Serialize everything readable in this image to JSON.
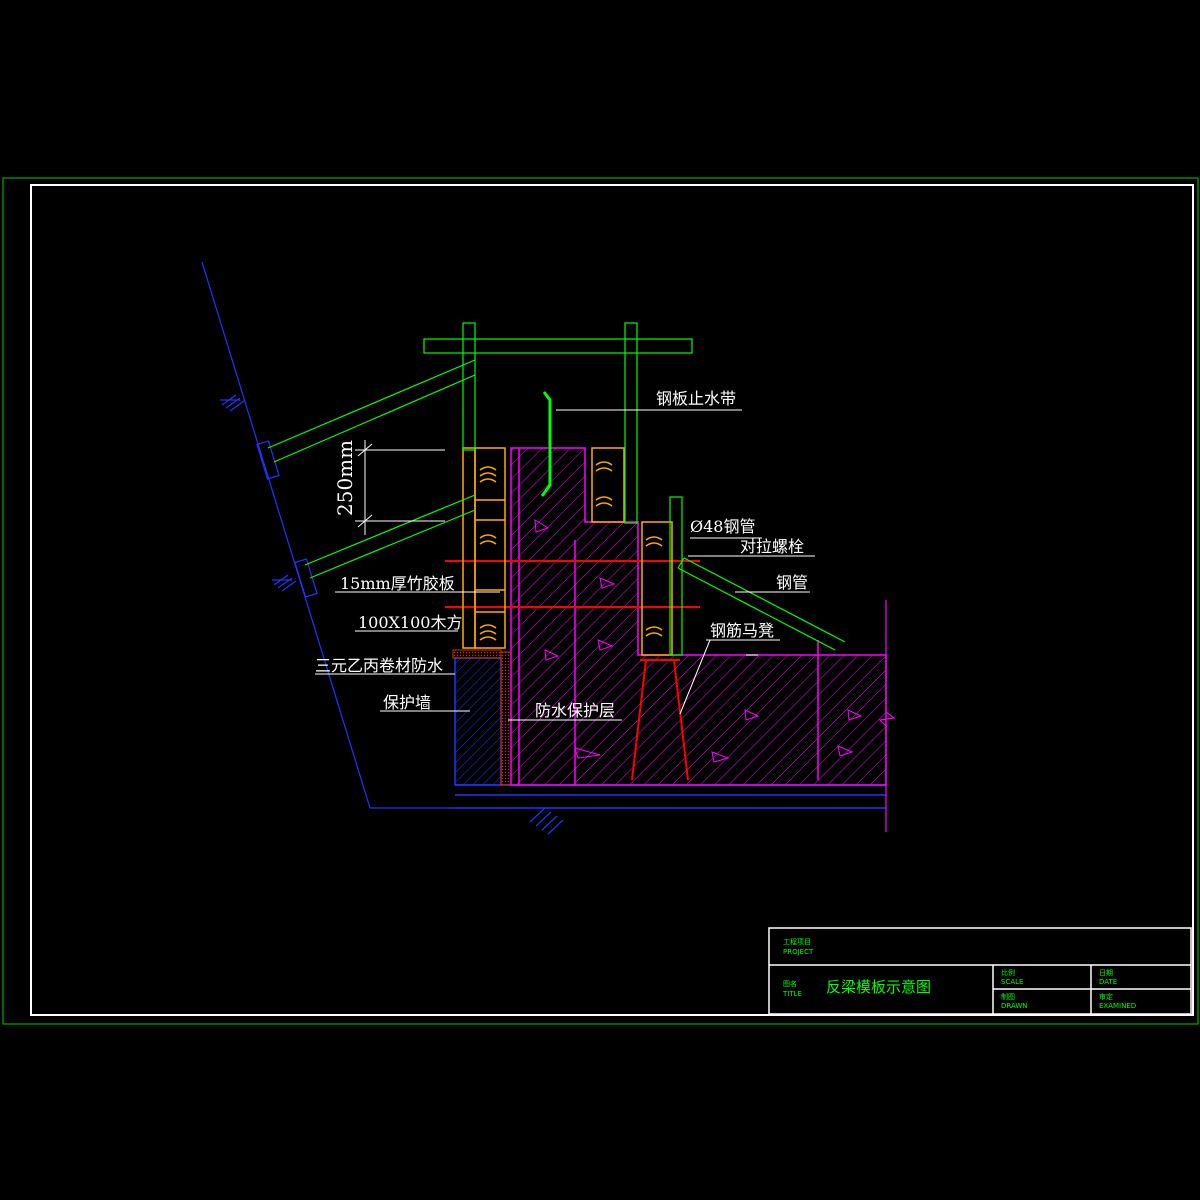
{
  "drawing": {
    "title": "反梁模板示意图",
    "dimension": "250mm",
    "labels": {
      "steel_waterstop": "钢板止水带",
      "steel_pipe_48": "Ø48钢管",
      "tie_bolt": "对拉螺栓",
      "steel_pipe": "钢管",
      "bamboo_plywood": "15mm厚竹胶板",
      "timber": "100X100木方",
      "rebar_chair": "钢筋马凳",
      "epdm_waterproof": "三元乙丙卷材防水",
      "protective_wall": "保护墙",
      "waterproof_protective_layer": "防水保护层"
    }
  },
  "title_block": {
    "project_cn": "工程项目",
    "project_en": "PROJECT",
    "title_cn": "图名",
    "title_en": "TITLE",
    "scale_cn": "比例",
    "scale_en": "SCALE",
    "date_cn": "日期",
    "date_en": "DATE",
    "drawn_cn": "制图",
    "drawn_en": "DRAWN",
    "examined_cn": "审定",
    "examined_en": "EXAMINED"
  },
  "colors": {
    "background": "#000000",
    "frame_outer": "#00cc00",
    "frame_inner": "#ffffff",
    "formwork": "#00ff00",
    "slope": "#2233ff",
    "concrete": "#ff00ff",
    "timber": "#ffaa00",
    "bolt": "#ff0000",
    "waterstop": "#00ff00"
  }
}
